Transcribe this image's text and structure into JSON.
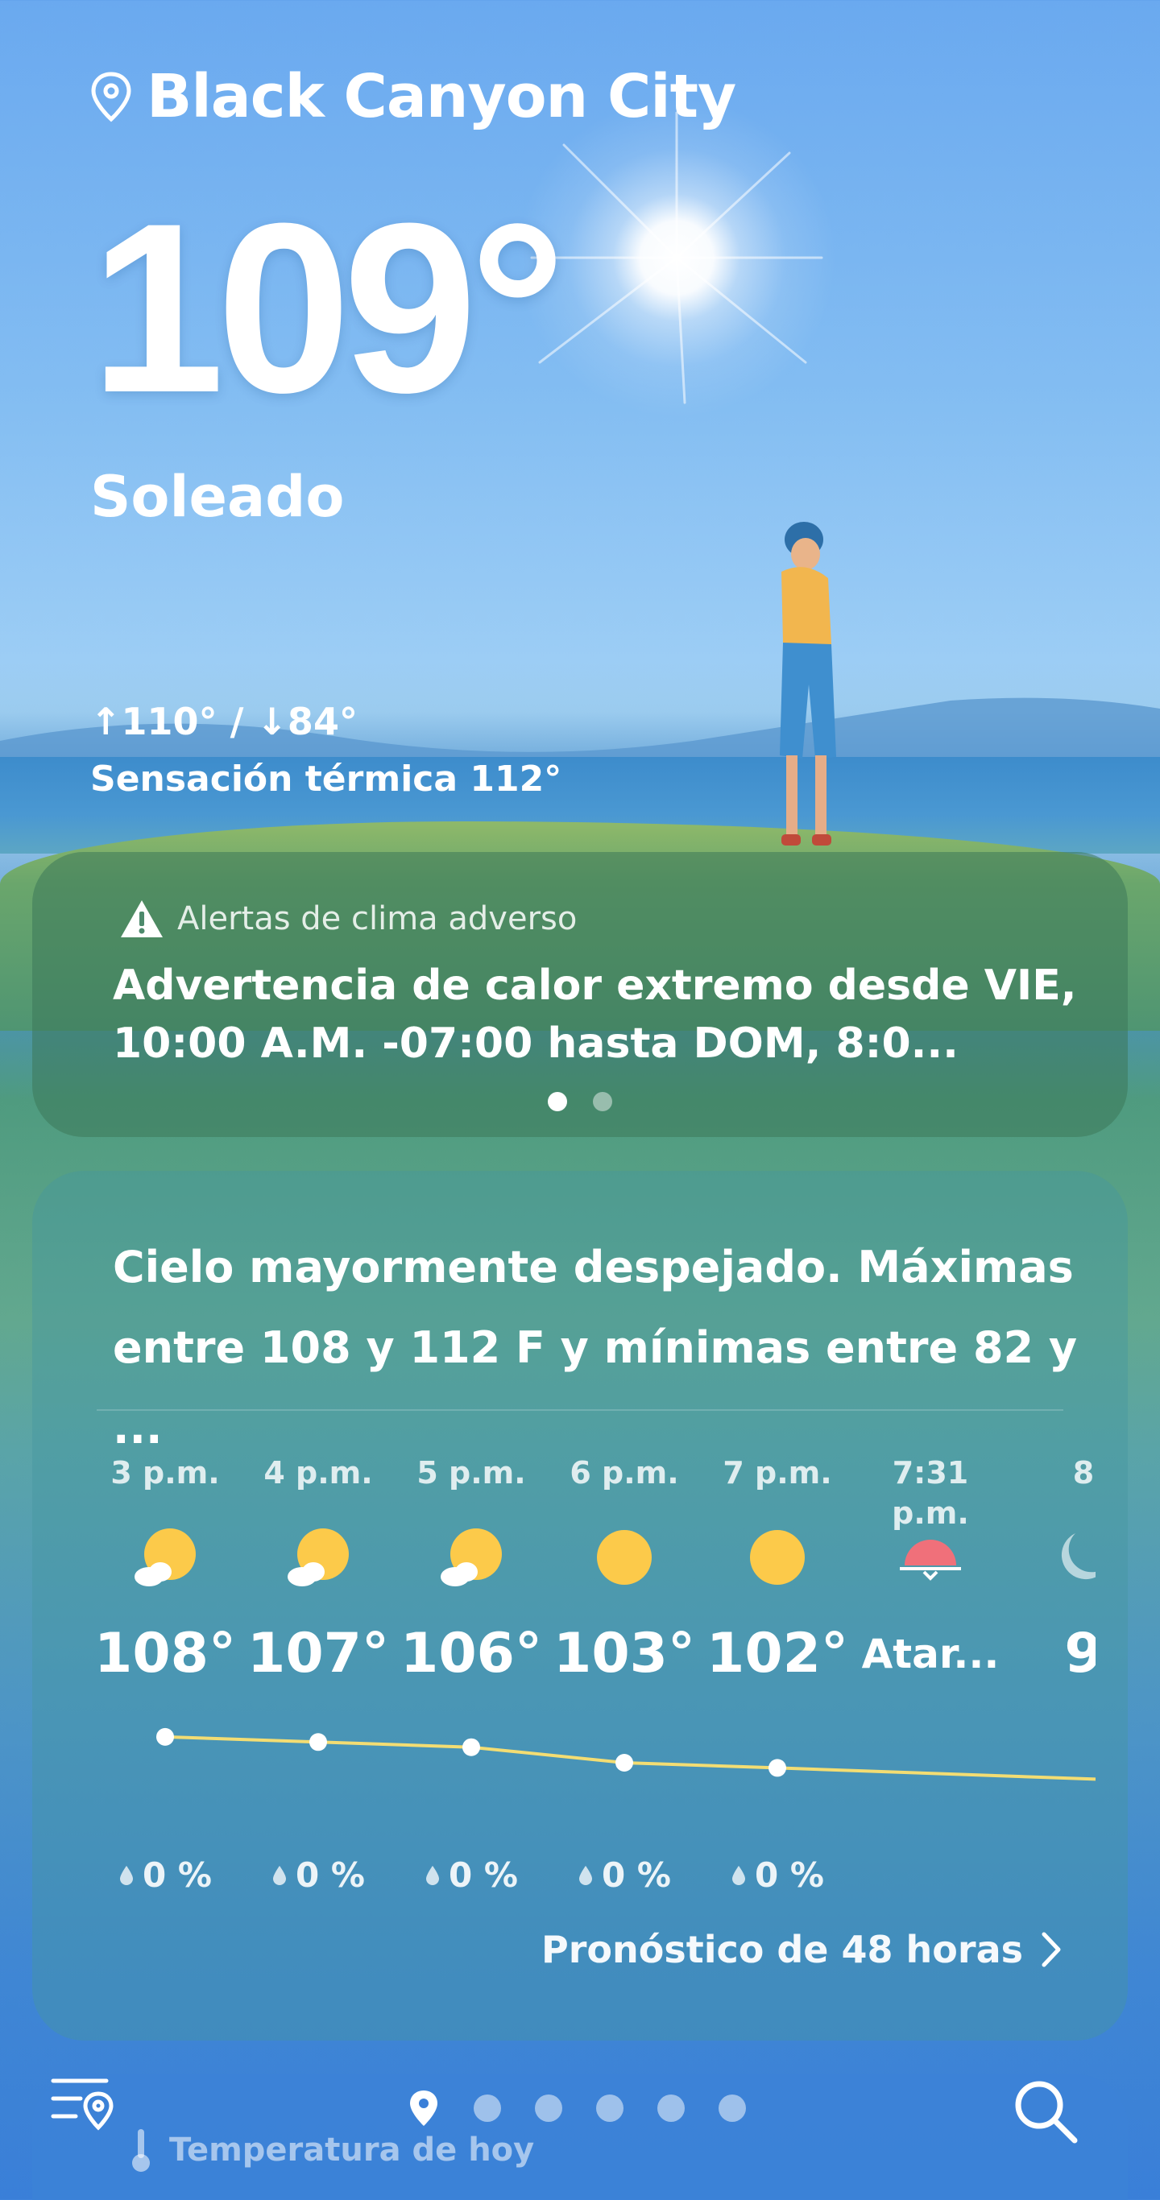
{
  "location": {
    "city": "Black Canyon City"
  },
  "current": {
    "temperature": "109°",
    "condition": "Soleado",
    "hi_lo": "↑110° / ↓84°",
    "feels_like": "Sensación térmica 112°"
  },
  "alert": {
    "header": "Alertas de clima adverso",
    "text": "Advertencia de calor extremo desde VIE, 10:00 A.M. -07:00 hasta DOM, 8:0...",
    "pages": 2,
    "active_page": 0
  },
  "forecast": {
    "summary": "Cielo mayormente despejado. Máximas entre 108 y 112 F y mínimas entre 82 y ...",
    "hours": [
      {
        "time": "3 p.m.",
        "icon": "partly-sunny-icon",
        "temp": "108°",
        "rain": "0 %"
      },
      {
        "time": "4 p.m.",
        "icon": "partly-sunny-icon",
        "temp": "107°",
        "rain": "0 %"
      },
      {
        "time": "5 p.m.",
        "icon": "partly-sunny-icon",
        "temp": "106°",
        "rain": "0 %"
      },
      {
        "time": "6 p.m.",
        "icon": "sun-icon",
        "temp": "103°",
        "rain": "0 %"
      },
      {
        "time": "7 p.m.",
        "icon": "sun-icon",
        "temp": "102°",
        "rain": "0 %"
      },
      {
        "time": "7:31 p.m.",
        "icon": "sunset-icon",
        "temp": "Atar...",
        "rain": ""
      },
      {
        "time": "8",
        "icon": "moon-icon",
        "temp": "9",
        "rain": ""
      }
    ],
    "trend_values": [
      108,
      107,
      106,
      103,
      102
    ],
    "link": "Pronóstico de 48 horas"
  },
  "bottom": {
    "today_label": "Temperatura de hoy",
    "page_count": 6,
    "active_page": 0
  },
  "colors": {
    "sun": "#fcca4a",
    "sunset": "#f0707a",
    "trend_line": "#f3dd73"
  }
}
